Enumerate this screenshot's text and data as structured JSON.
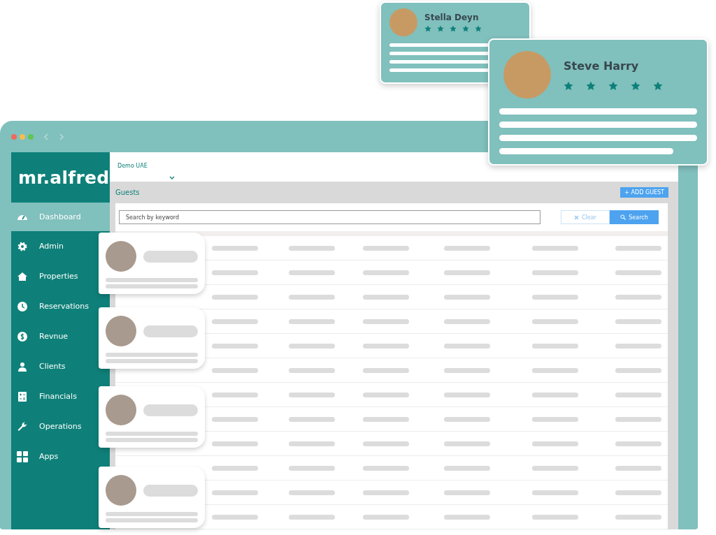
{
  "logo": "mr.alfred",
  "sidebar": {
    "items": [
      {
        "label": "Dashboard",
        "kind": "gauge",
        "selected": true
      },
      {
        "label": "Admin",
        "kind": "gear",
        "selected": false
      },
      {
        "label": "Properties",
        "kind": "house",
        "selected": false
      },
      {
        "label": "Reservations",
        "kind": "clock",
        "selected": false
      },
      {
        "label": "Revnue",
        "kind": "dollar",
        "selected": false
      },
      {
        "label": "Clients",
        "kind": "person",
        "selected": false
      },
      {
        "label": "Financials",
        "kind": "calculator",
        "selected": false
      },
      {
        "label": "Operations",
        "kind": "wrench",
        "selected": false
      },
      {
        "label": "Apps",
        "kind": "grid",
        "selected": false
      }
    ]
  },
  "header": {
    "property": "Demo UAE"
  },
  "page": {
    "title": "Guests",
    "add_button": "+ ADD GUEST"
  },
  "search": {
    "placeholder": "Search by keyword",
    "clear": "Clear",
    "submit": "Search"
  },
  "profile_cards": [
    {
      "name": "Stella Deyn",
      "stars": 5
    },
    {
      "name": "Steve Harry",
      "stars": 5
    }
  ]
}
